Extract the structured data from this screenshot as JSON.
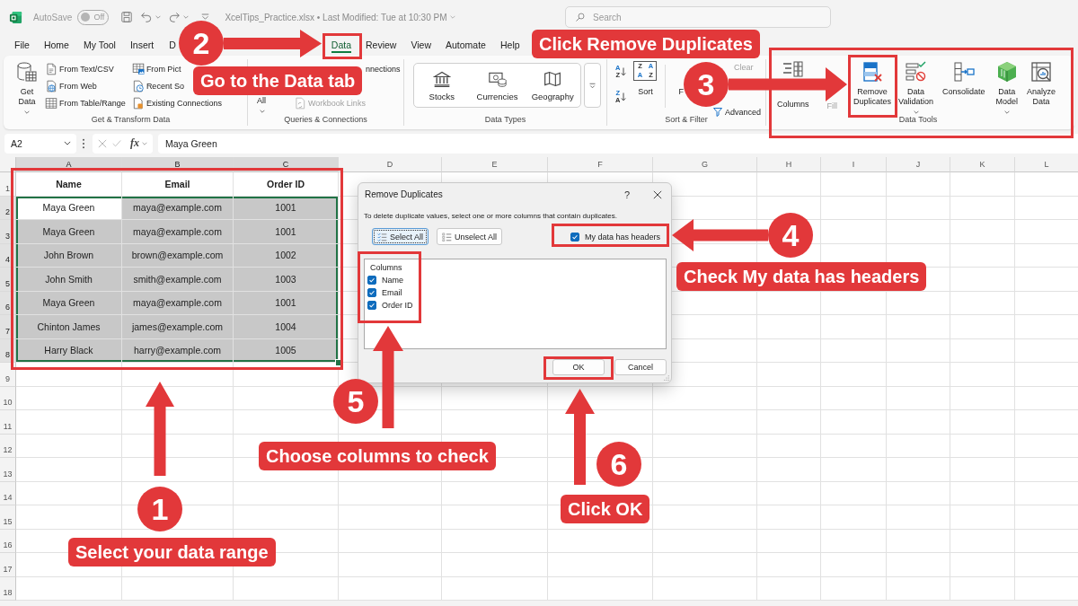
{
  "title_bar": {
    "autosave": {
      "label": "AutoSave",
      "state_text": "Off",
      "on": false
    },
    "file_title": "XcelTips_Practice.xlsx • Last Modified: Tue at 10:30 PM",
    "search": {
      "placeholder": "Search"
    }
  },
  "tabs": [
    {
      "label": "File",
      "selected": false
    },
    {
      "label": "Home",
      "selected": false
    },
    {
      "label": "My Tool",
      "selected": false
    },
    {
      "label": "Insert",
      "selected": false
    },
    {
      "label": "D",
      "selected": false
    },
    {
      "label": "Data",
      "selected": true
    },
    {
      "label": "Review",
      "selected": false
    },
    {
      "label": "View",
      "selected": false
    },
    {
      "label": "Automate",
      "selected": false
    },
    {
      "label": "Help",
      "selected": false
    }
  ],
  "ribbon_groups": [
    {
      "label": "Get & Transform Data",
      "controls": [
        {
          "kind": "large",
          "label": "Get Data",
          "dropdown": true,
          "disabled": false
        },
        {
          "kind": "stack",
          "items": [
            {
              "label": "From Text/CSV",
              "disabled": false
            },
            {
              "label": "From Web",
              "disabled": false
            },
            {
              "label": "From Table/Range",
              "disabled": false
            }
          ]
        },
        {
          "kind": "stack",
          "items": [
            {
              "label": "From Pict",
              "disabled": false
            },
            {
              "label": "Recent So",
              "disabled": false
            },
            {
              "label": "Existing Connections",
              "disabled": false
            }
          ]
        }
      ]
    },
    {
      "label": "Queries & Connections",
      "controls": [
        {
          "kind": "large",
          "label": "All",
          "dropdown": true,
          "disabled": false
        },
        {
          "kind": "stack",
          "items": [
            {
              "label": "nnections",
              "disabled": false
            },
            {
              "label": "Workbook Links",
              "disabled": true
            }
          ]
        }
      ]
    },
    {
      "label": "Data Types",
      "controls": [
        {
          "kind": "gallery",
          "items": [
            {
              "label": "Stocks"
            },
            {
              "label": "Currencies"
            },
            {
              "label": "Geography"
            }
          ]
        }
      ]
    },
    {
      "label": "Sort & Filter",
      "controls": [
        {
          "kind": "sort_pair",
          "buttons": [
            {
              "letters": [
                "A",
                "Z"
              ]
            },
            {
              "letters": [
                "Z",
                "A"
              ]
            }
          ]
        },
        {
          "kind": "large",
          "label": "Sort",
          "dropdown": false,
          "disabled": false,
          "grid_letters": [
            "Z",
            "A",
            "A",
            "Z"
          ]
        },
        {
          "kind": "large",
          "label": "F",
          "dropdown": false,
          "disabled": false
        },
        {
          "kind": "stack",
          "items": [
            {
              "label": "Clear",
              "disabled": true
            },
            {
              "label": "Advanced",
              "disabled": false
            }
          ]
        }
      ]
    },
    {
      "label": "Data Tools",
      "controls": [
        {
          "kind": "large",
          "label": "Columns",
          "dropdown": false,
          "disabled": false
        },
        {
          "kind": "large",
          "label": "Fill",
          "dropdown": false,
          "disabled": true
        },
        {
          "kind": "large",
          "label": "Remove Duplicates",
          "dropdown": false,
          "disabled": false
        },
        {
          "kind": "large",
          "label": "Data Validation",
          "dropdown": true,
          "disabled": false
        },
        {
          "kind": "large",
          "label": "Consolidate",
          "dropdown": false,
          "disabled": false
        },
        {
          "kind": "large",
          "label": "Data Model",
          "dropdown": true,
          "disabled": false
        },
        {
          "kind": "large",
          "label": "Analyze Data",
          "dropdown": false,
          "disabled": false
        }
      ]
    }
  ],
  "formula_bar": {
    "name_box": "A2",
    "function_label": "fx",
    "formula": "Maya Green"
  },
  "sheet": {
    "columns": [
      "A",
      "B",
      "C",
      "D",
      "E",
      "F",
      "G",
      "H",
      "I",
      "J",
      "K",
      "L"
    ],
    "row_numbers": [
      "1",
      "2",
      "3",
      "4",
      "5",
      "6",
      "7",
      "8",
      "9",
      "10",
      "11",
      "12",
      "13",
      "14",
      "15",
      "16",
      "17",
      "18"
    ],
    "rows": [
      {
        "kind": "header",
        "cells": [
          {
            "text": "Name",
            "selected": false,
            "active": false
          },
          {
            "text": "Email",
            "selected": false,
            "active": false
          },
          {
            "text": "Order ID",
            "selected": false,
            "active": false
          }
        ]
      },
      {
        "kind": "data",
        "cells": [
          {
            "text": "Maya Green",
            "selected": true,
            "active": true
          },
          {
            "text": "maya@example.com",
            "selected": true,
            "active": false
          },
          {
            "text": "1001",
            "selected": true,
            "active": false
          }
        ]
      },
      {
        "kind": "data",
        "cells": [
          {
            "text": "Maya Green",
            "selected": true,
            "active": false
          },
          {
            "text": "maya@example.com",
            "selected": true,
            "active": false
          },
          {
            "text": "1001",
            "selected": true,
            "active": false
          }
        ]
      },
      {
        "kind": "data",
        "cells": [
          {
            "text": "John Brown",
            "selected": true,
            "active": false
          },
          {
            "text": "brown@example.com",
            "selected": true,
            "active": false
          },
          {
            "text": "1002",
            "selected": true,
            "active": false
          }
        ]
      },
      {
        "kind": "data",
        "cells": [
          {
            "text": "John Smith",
            "selected": true,
            "active": false
          },
          {
            "text": "smith@example.com",
            "selected": true,
            "active": false
          },
          {
            "text": "1003",
            "selected": true,
            "active": false
          }
        ]
      },
      {
        "kind": "data",
        "cells": [
          {
            "text": "Maya Green",
            "selected": true,
            "active": false
          },
          {
            "text": "maya@example.com",
            "selected": true,
            "active": false
          },
          {
            "text": "1001",
            "selected": true,
            "active": false
          }
        ]
      },
      {
        "kind": "data",
        "cells": [
          {
            "text": "Chinton James",
            "selected": true,
            "active": false
          },
          {
            "text": "james@example.com",
            "selected": true,
            "active": false
          },
          {
            "text": "1004",
            "selected": true,
            "active": false
          }
        ]
      },
      {
        "kind": "data",
        "cells": [
          {
            "text": "Harry Black",
            "selected": true,
            "active": false
          },
          {
            "text": "harry@example.com",
            "selected": true,
            "active": false
          },
          {
            "text": "1005",
            "selected": true,
            "active": false
          }
        ]
      }
    ]
  },
  "dialog": {
    "title": "Remove Duplicates",
    "help": "?",
    "description": "To delete duplicate values, select one or more columns that contain duplicates.",
    "select_buttons": [
      {
        "label": "Select All",
        "focused": true
      },
      {
        "label": "Unselect All",
        "focused": false
      }
    ],
    "headers_checkbox": {
      "label": "My data has headers",
      "checked": true
    },
    "columns_list": {
      "heading": "Columns",
      "items": [
        {
          "label": "Name",
          "checked": true
        },
        {
          "label": "Email",
          "checked": true
        },
        {
          "label": "Order ID",
          "checked": true
        }
      ]
    },
    "buttons": [
      "OK",
      "Cancel"
    ]
  },
  "steps": [
    {
      "number": "1",
      "instruction": "Select your data range"
    },
    {
      "number": "2",
      "instruction": "Go to the Data tab"
    },
    {
      "number": "3",
      "instruction": "Click Remove Duplicates"
    },
    {
      "number": "4",
      "instruction": "Check My data has headers"
    },
    {
      "number": "5",
      "instruction": "Choose columns to check"
    },
    {
      "number": "6",
      "instruction": "Click OK"
    }
  ]
}
